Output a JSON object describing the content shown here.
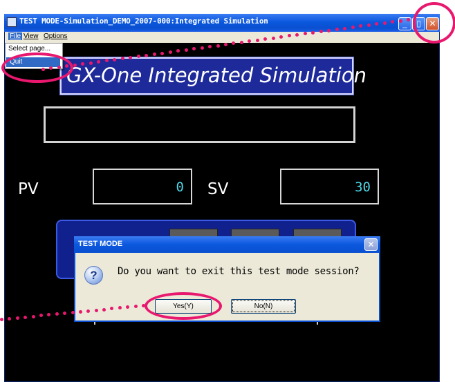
{
  "window": {
    "title": "TEST MODE-Simulation_DEMO_2007-000:Integrated Simulation",
    "minimize_glyph": "_",
    "maximize_glyph": "▯",
    "close_glyph": "✕"
  },
  "menubar": {
    "items": [
      "File",
      "View",
      "Options"
    ]
  },
  "file_menu": {
    "items": [
      "Select page...",
      "Quit"
    ]
  },
  "app": {
    "title": "GX-One Integrated Simulation",
    "pv_label": "PV",
    "pv_value": "0",
    "sv_label": "SV",
    "sv_value": "30"
  },
  "dialog": {
    "title": "TEST MODE",
    "icon": "question-icon",
    "icon_glyph": "?",
    "message": "Do you want to exit this test mode session?",
    "yes_label": "Yes(Y)",
    "no_label": "No(N)",
    "close_glyph": "✕"
  },
  "colors": {
    "annotation": "#e8186f",
    "value_text": "#4fd6e8",
    "title_panel": "#1e2a9a",
    "button_panel": "#10208c"
  }
}
